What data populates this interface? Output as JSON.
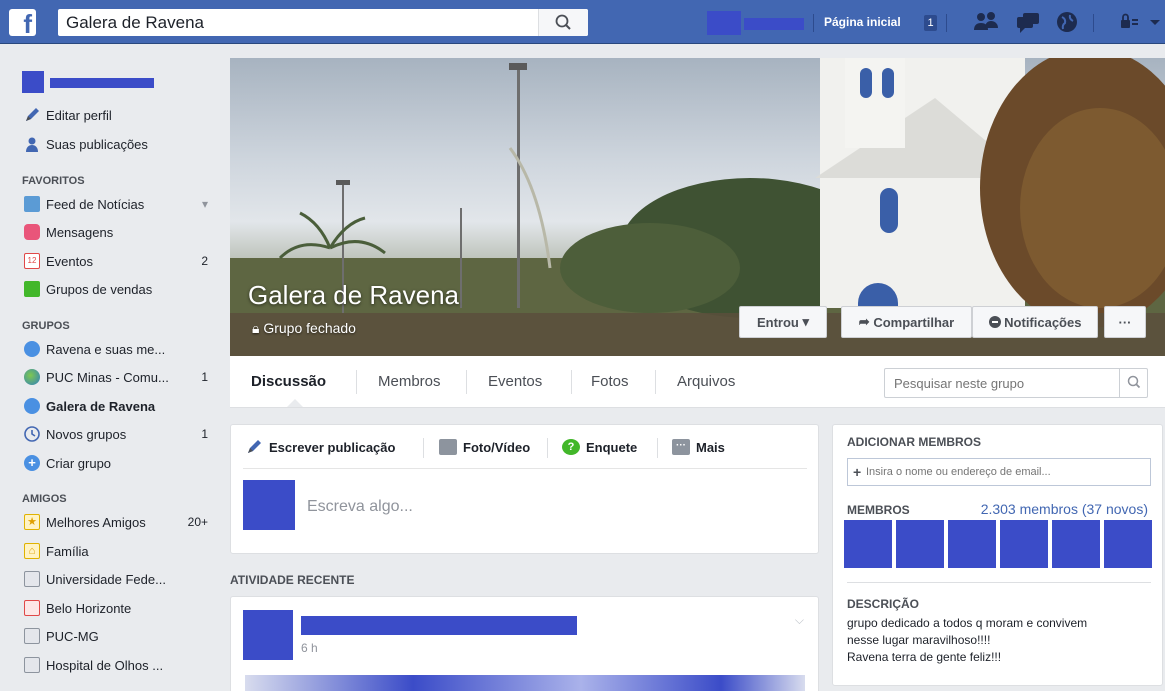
{
  "topbar": {
    "logo_letter": "f",
    "search_value": "Galera de Ravena",
    "home_label": "Página inicial",
    "home_count": "1"
  },
  "leftnav": {
    "profile_links": [
      {
        "label": "Editar perfil",
        "icon": "pencil-icon"
      },
      {
        "label": "Suas publicações",
        "icon": "person-icon"
      }
    ],
    "favorites_header": "FAVORITOS",
    "favorites": [
      {
        "label": "Feed de Notícias",
        "icon": "news-feed-icon",
        "count": ""
      },
      {
        "label": "Mensagens",
        "icon": "messages-icon",
        "count": ""
      },
      {
        "label": "Eventos",
        "icon": "calendar-icon",
        "count": "2",
        "icon_text": "12"
      },
      {
        "label": "Grupos de vendas",
        "icon": "sale-groups-icon",
        "count": ""
      }
    ],
    "groups_header": "GRUPOS",
    "groups": [
      {
        "label": "Ravena e suas me...",
        "icon": "group-icon",
        "count": ""
      },
      {
        "label": "PUC Minas - Comu...",
        "icon": "globe-icon",
        "count": "1"
      },
      {
        "label": "Galera de Ravena",
        "icon": "group-icon",
        "count": "",
        "active": true
      },
      {
        "label": "Novos grupos",
        "icon": "clock-icon",
        "count": "1"
      },
      {
        "label": "Criar grupo",
        "icon": "plus-circle-icon",
        "count": ""
      }
    ],
    "friends_header": "AMIGOS",
    "friends": [
      {
        "label": "Melhores Amigos",
        "icon": "star-icon",
        "count": "20+"
      },
      {
        "label": "Família",
        "icon": "house-icon",
        "count": ""
      },
      {
        "label": "Universidade Fede...",
        "icon": "school-icon",
        "count": ""
      },
      {
        "label": "Belo Horizonte",
        "icon": "location-pin-icon",
        "count": ""
      },
      {
        "label": "PUC-MG",
        "icon": "building-icon",
        "count": ""
      },
      {
        "label": "Hospital de Olhos ...",
        "icon": "building-icon",
        "count": ""
      }
    ]
  },
  "cover": {
    "title": "Galera de Ravena",
    "privacy": "Grupo fechado",
    "joined_label": "Entrou",
    "share_label": "Compartilhar",
    "notifications_label": "Notificações",
    "more_label": "···"
  },
  "tabs": {
    "items": [
      "Discussão",
      "Membros",
      "Eventos",
      "Fotos",
      "Arquivos"
    ],
    "search_placeholder": "Pesquisar neste grupo"
  },
  "composer": {
    "write_label": "Escrever publicação",
    "photo_label": "Foto/Vídeo",
    "poll_label": "Enquete",
    "more_label": "Mais",
    "placeholder": "Escreva algo..."
  },
  "activity": {
    "header": "ATIVIDADE RECENTE",
    "post_time": "6 h"
  },
  "sidebar": {
    "add_members_header": "ADICIONAR MEMBROS",
    "add_members_placeholder": "Insira o nome ou endereço de email...",
    "members_header": "MEMBROS",
    "members_count": "2.303 membros (37 novos)",
    "description_header": "DESCRIÇÃO",
    "description_lines": [
      "grupo dedicado a todos q moram e convivem",
      "nesse lugar maravilhoso!!!!",
      "Ravena terra de gente feliz!!!"
    ]
  },
  "colors": {
    "brand": "#4267b2",
    "redaction": "#3b4cc8"
  }
}
